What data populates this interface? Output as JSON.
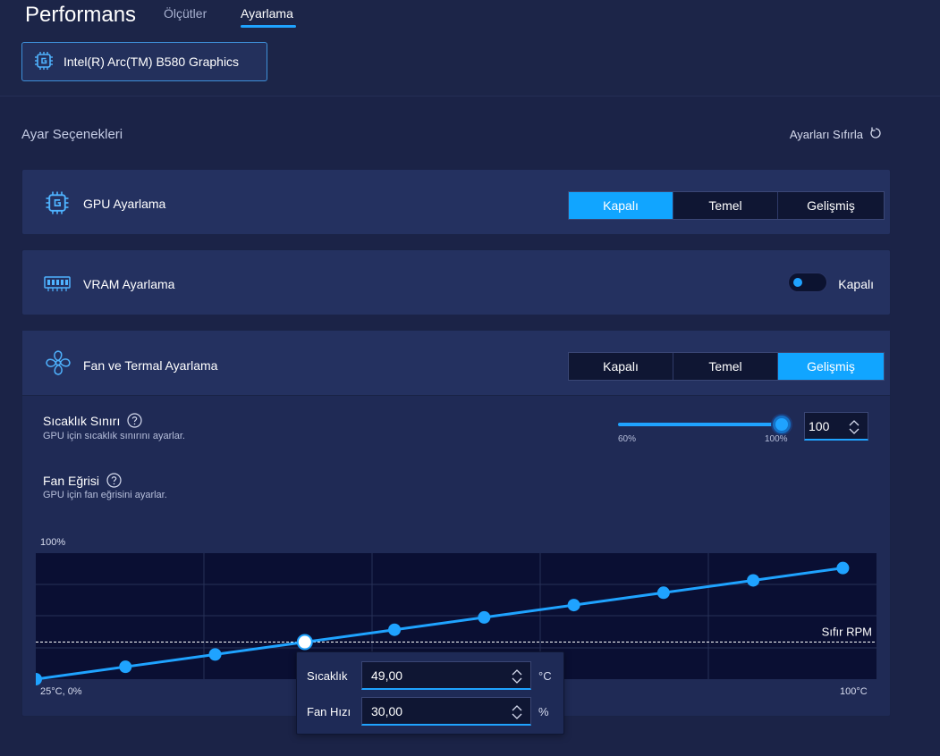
{
  "app": {
    "title": "Performans"
  },
  "tabs": [
    {
      "label": "Ölçütler",
      "active": false
    },
    {
      "label": "Ayarlama",
      "active": true
    }
  ],
  "device": {
    "name": "Intel(R) Arc(TM) B580 Graphics",
    "icon": "gpu-chip-icon"
  },
  "section": {
    "title": "Ayar Seçenekleri",
    "reset_label": "Ayarları Sıfırla"
  },
  "gpu_tuning": {
    "title": "GPU Ayarlama",
    "options": [
      "Kapalı",
      "Temel",
      "Gelişmiş"
    ],
    "selected": "Kapalı"
  },
  "vram_tuning": {
    "title": "VRAM Ayarlama",
    "toggle_label": "Kapalı",
    "enabled": false
  },
  "fan_tuning": {
    "title": "Fan ve Termal Ayarlama",
    "options": [
      "Kapalı",
      "Temel",
      "Gelişmiş"
    ],
    "selected": "Gelişmiş",
    "temp_limit": {
      "title": "Sıcaklık Sınırı",
      "description": "GPU için sıcaklık sınırını ayarlar.",
      "min_label": "60%",
      "max_label": "100%",
      "value": "100",
      "slider_fraction": 1.0
    },
    "fan_curve": {
      "title": "Fan Eğrisi",
      "description": "GPU için fan eğrisini ayarlar.",
      "y_max_label": "100%",
      "x_min_label": "25°C, 0%",
      "x_max_label": "100°C",
      "zero_rpm_label": "Sıfır RPM"
    },
    "point_editor": {
      "temp_label": "Sıcaklık",
      "temp_value": "49,00",
      "temp_unit": "°C",
      "fan_label": "Fan Hızı",
      "fan_value": "30,00",
      "fan_unit": "%"
    }
  },
  "colors": {
    "accent": "#1fa3ff",
    "background": "#1b2347",
    "card": "#243160",
    "plot": "#0a0f33"
  },
  "chart_data": {
    "type": "line",
    "xlim": [
      25,
      100
    ],
    "ylim": [
      0,
      100
    ],
    "zero_rpm_threshold": 30,
    "series": [
      {
        "x": [
          25,
          33,
          41,
          49,
          57,
          65,
          73,
          81,
          89,
          97
        ],
        "y": [
          0,
          10,
          20,
          30,
          40,
          50,
          60,
          70,
          80,
          90
        ]
      }
    ],
    "selected_index": 3
  }
}
